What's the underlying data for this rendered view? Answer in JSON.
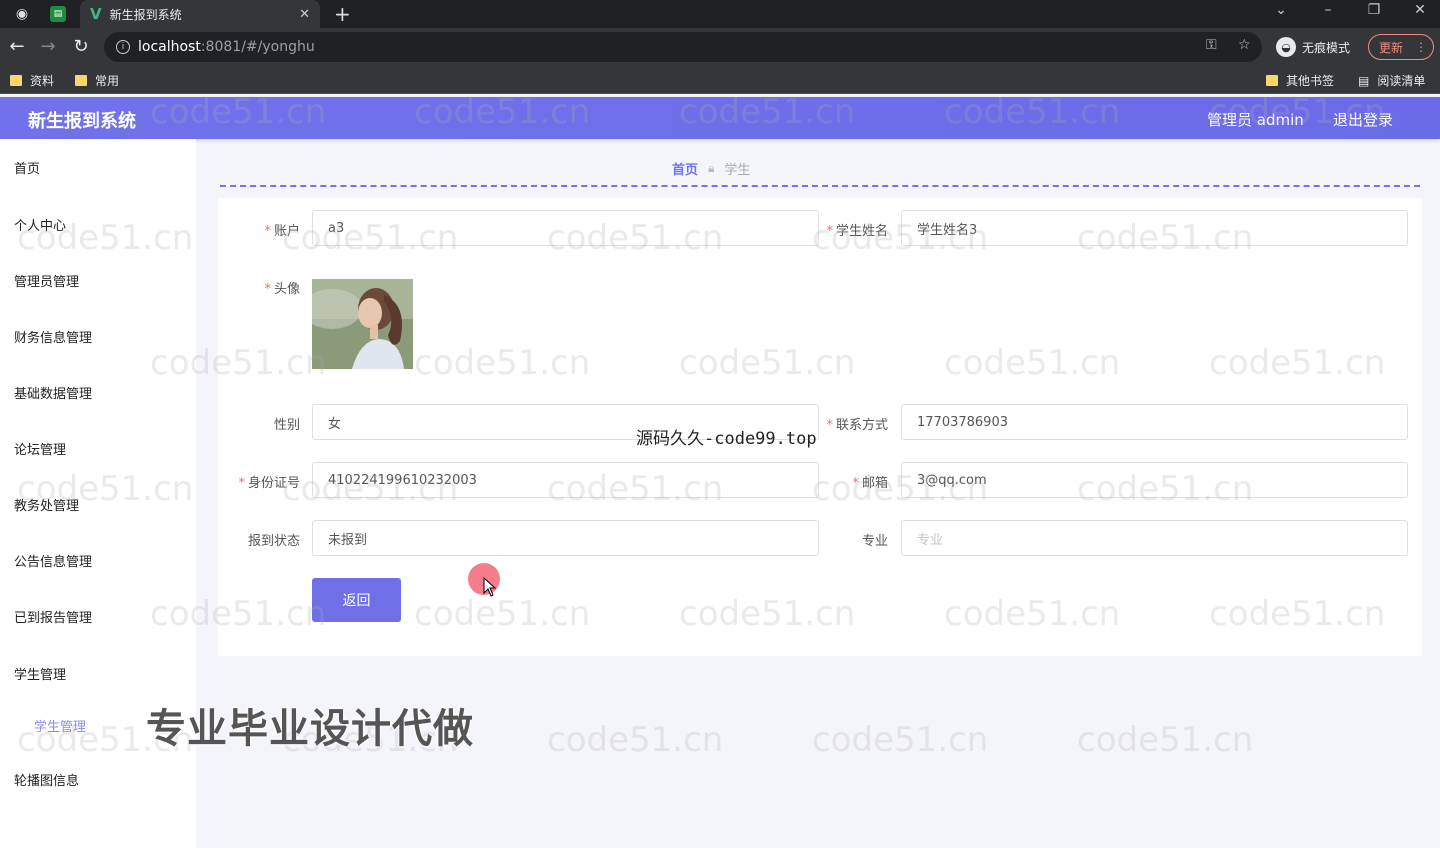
{
  "browser": {
    "tab_title": "新生报到系统",
    "url_host": "localhost",
    "url_path": ":8081/#/yonghu",
    "incognito_label": "无痕模式",
    "update_label": "更新",
    "bookmarks": [
      "资料",
      "常用"
    ],
    "bookmarks_right": [
      "其他书签",
      "阅读清单"
    ]
  },
  "app": {
    "title": "新生报到系统",
    "user_label": "管理员 admin",
    "logout_label": "退出登录"
  },
  "sidebar": {
    "items": [
      "首页",
      "个人中心",
      "管理员管理",
      "财务信息管理",
      "基础数据管理",
      "论坛管理",
      "教务处管理",
      "公告信息管理",
      "已到报告管理",
      "学生管理"
    ],
    "sub_item": "学生管理",
    "last_item": "轮播图信息"
  },
  "breadcrumb": {
    "home": "首页",
    "current": "学生"
  },
  "form": {
    "account_label": "账户",
    "account_value": "a3",
    "name_label": "学生姓名",
    "name_value": "学生姓名3",
    "avatar_label": "头像",
    "gender_label": "性别",
    "gender_value": "女",
    "phone_label": "联系方式",
    "phone_value": "17703786903",
    "idcard_label": "身份证号",
    "idcard_value": "410224199610232003",
    "email_label": "邮箱",
    "email_value": "3@qq.com",
    "status_label": "报到状态",
    "status_value": "未报到",
    "major_label": "专业",
    "major_placeholder": "专业",
    "back_label": "返回"
  },
  "overlays": {
    "watermark": "code51.cn",
    "code99": "源码久久-code99.top",
    "promo": "专业毕业设计代做"
  }
}
